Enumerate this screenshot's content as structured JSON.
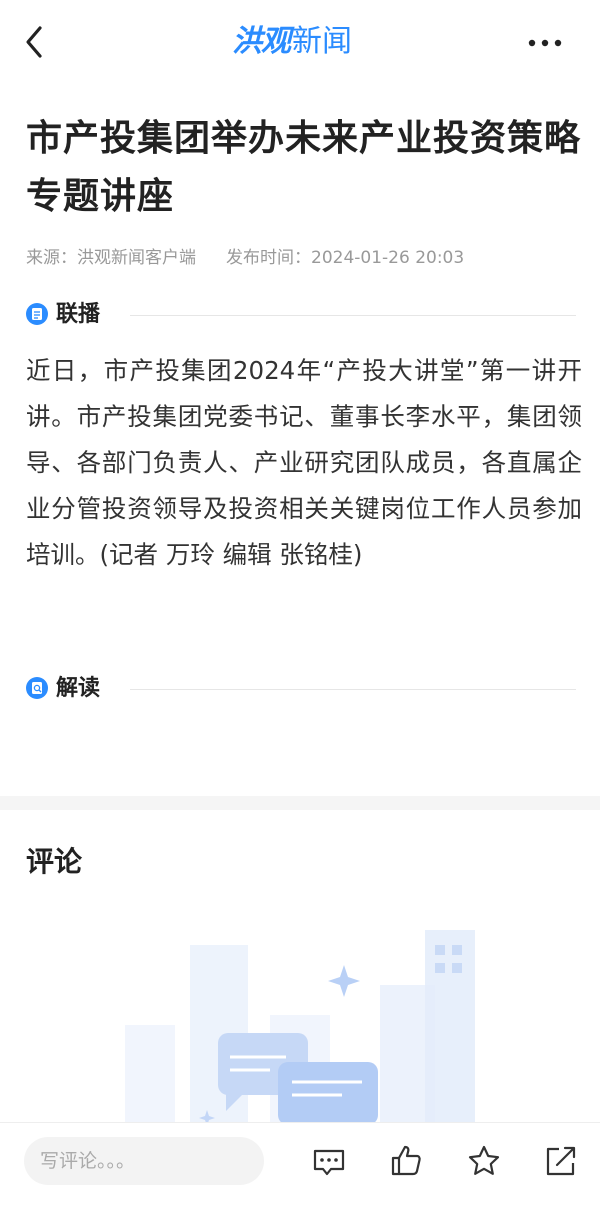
{
  "header": {
    "logo_part1": "洪观",
    "logo_part2": "新闻"
  },
  "article": {
    "title": "市产投集团举办未来产业投资策略专题讲座",
    "source": "来源：洪观新闻客户端",
    "publish_time": "发布时间：2024-01-26 20:03",
    "sections": [
      {
        "label": "联播",
        "icon": "document-icon"
      },
      {
        "label": "解读",
        "icon": "interpret-icon"
      }
    ],
    "body": "近日，市产投集团2024年“产投大讲堂”第一讲开讲。市产投集团党委书记、董事长李水平，集团领导、各部门负责人、产业研究团队成员，各直属企业分管投资领导及投资相关关键岗位工作人员参加培训。(记者 万玲 编辑 张铭桂)"
  },
  "comments": {
    "title": "评论"
  },
  "bottom_bar": {
    "input_placeholder": "写评论。。。",
    "icons": [
      "comment-icon",
      "like-icon",
      "favorite-icon",
      "share-icon"
    ]
  },
  "colors": {
    "brand": "#2b8cff",
    "text": "#222222",
    "meta": "#999999"
  }
}
